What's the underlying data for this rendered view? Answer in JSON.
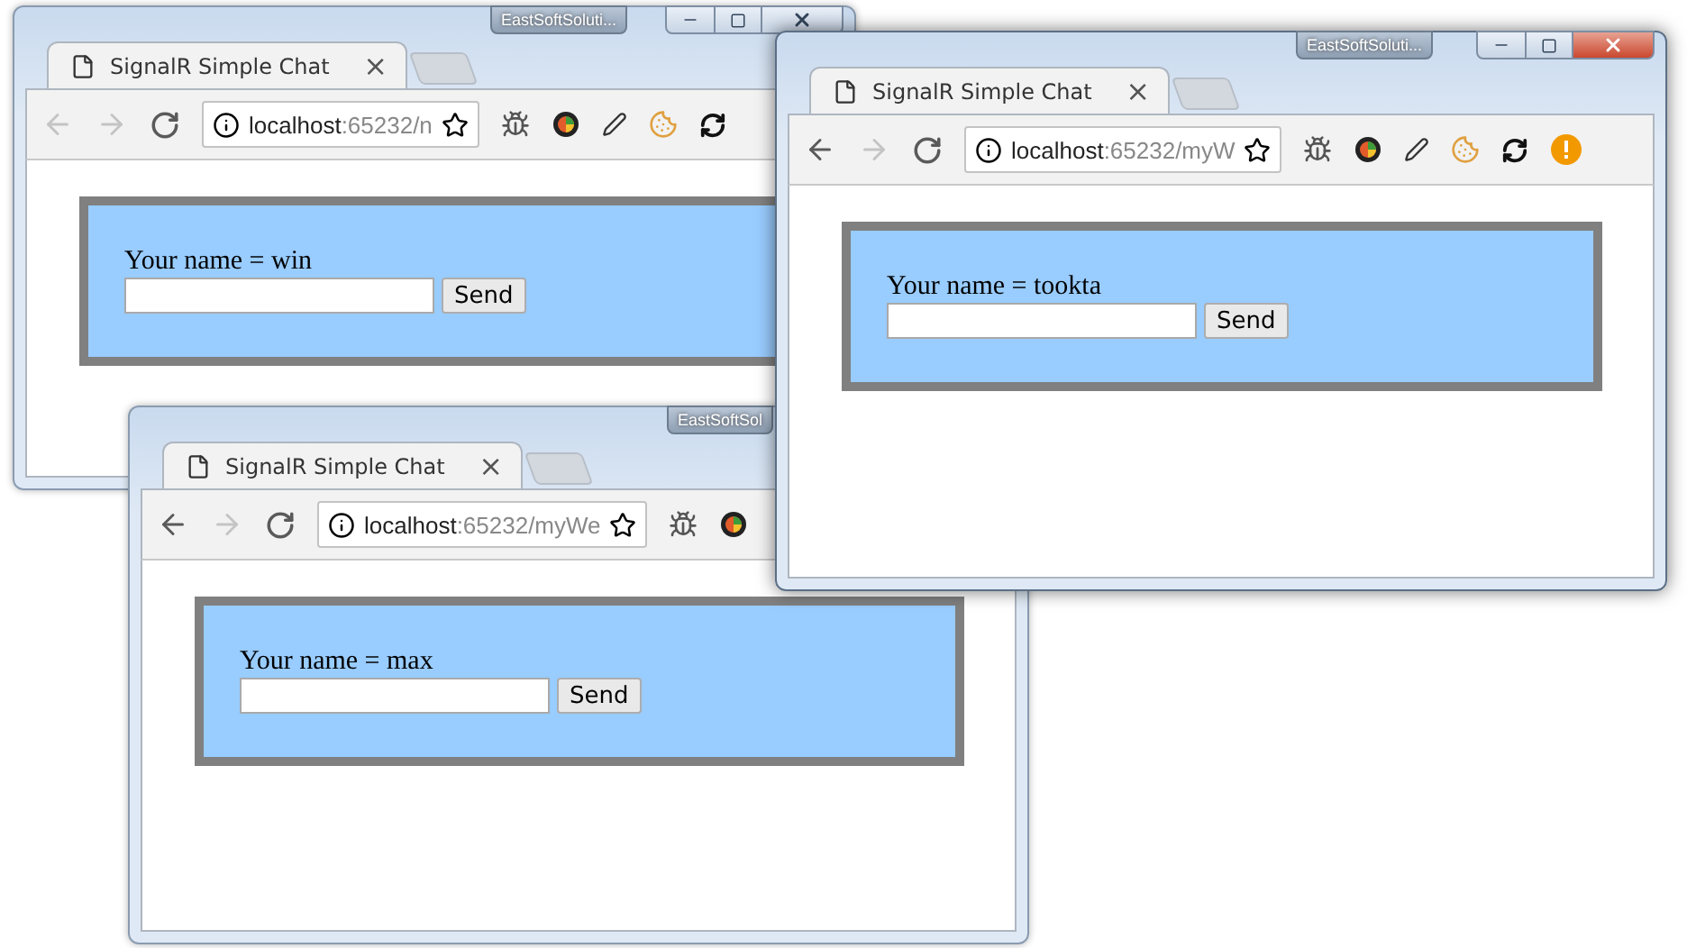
{
  "windows": [
    {
      "caption_badge": "EastSoftSoluti...",
      "focused": false,
      "tab": {
        "title": "SignalR Simple Chat",
        "close": "×"
      },
      "url": {
        "host": "localhost",
        "path": ":65232/n"
      },
      "back_enabled": false,
      "page": {
        "label": "Your name = win",
        "button": "Send"
      }
    },
    {
      "caption_badge": "EastSoftSol",
      "focused": false,
      "tab": {
        "title": "SignalR Simple Chat",
        "close": "×"
      },
      "url": {
        "host": "localhost",
        "path": ":65232/myWe"
      },
      "back_enabled": true,
      "page": {
        "label": "Your name = max",
        "button": "Send"
      }
    },
    {
      "caption_badge": "EastSoftSoluti...",
      "focused": true,
      "tab": {
        "title": "SignalR Simple Chat",
        "close": "×"
      },
      "url": {
        "host": "localhost",
        "path": ":65232/myW"
      },
      "back_enabled": true,
      "page": {
        "label": "Your name = tookta",
        "button": "Send"
      }
    }
  ]
}
